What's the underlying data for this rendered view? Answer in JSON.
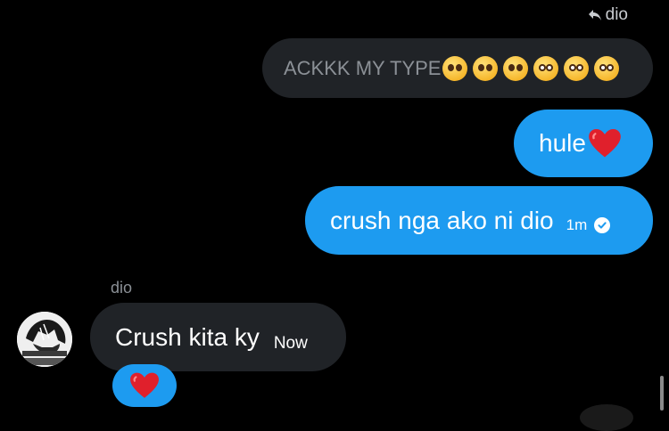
{
  "reply_context": {
    "label": "dio"
  },
  "quoted_message": {
    "text": "ACKKK MY TYPE",
    "emojis": [
      "pleading-face",
      "pleading-face",
      "pleading-face",
      "flushed-face",
      "flushed-face",
      "flushed-face"
    ]
  },
  "sent_messages": [
    {
      "text": "hule",
      "emoji": "red-heart"
    },
    {
      "text": "crush nga ako ni dio",
      "time": "1m",
      "status": "seen"
    }
  ],
  "received_message": {
    "sender": "dio",
    "text": "Crush kita ky",
    "time": "Now",
    "reaction": "red-heart"
  },
  "colors": {
    "background": "#000000",
    "sent_bubble": "#1d9bf0",
    "received_bubble": "#202327",
    "muted_text": "#8b9096"
  }
}
